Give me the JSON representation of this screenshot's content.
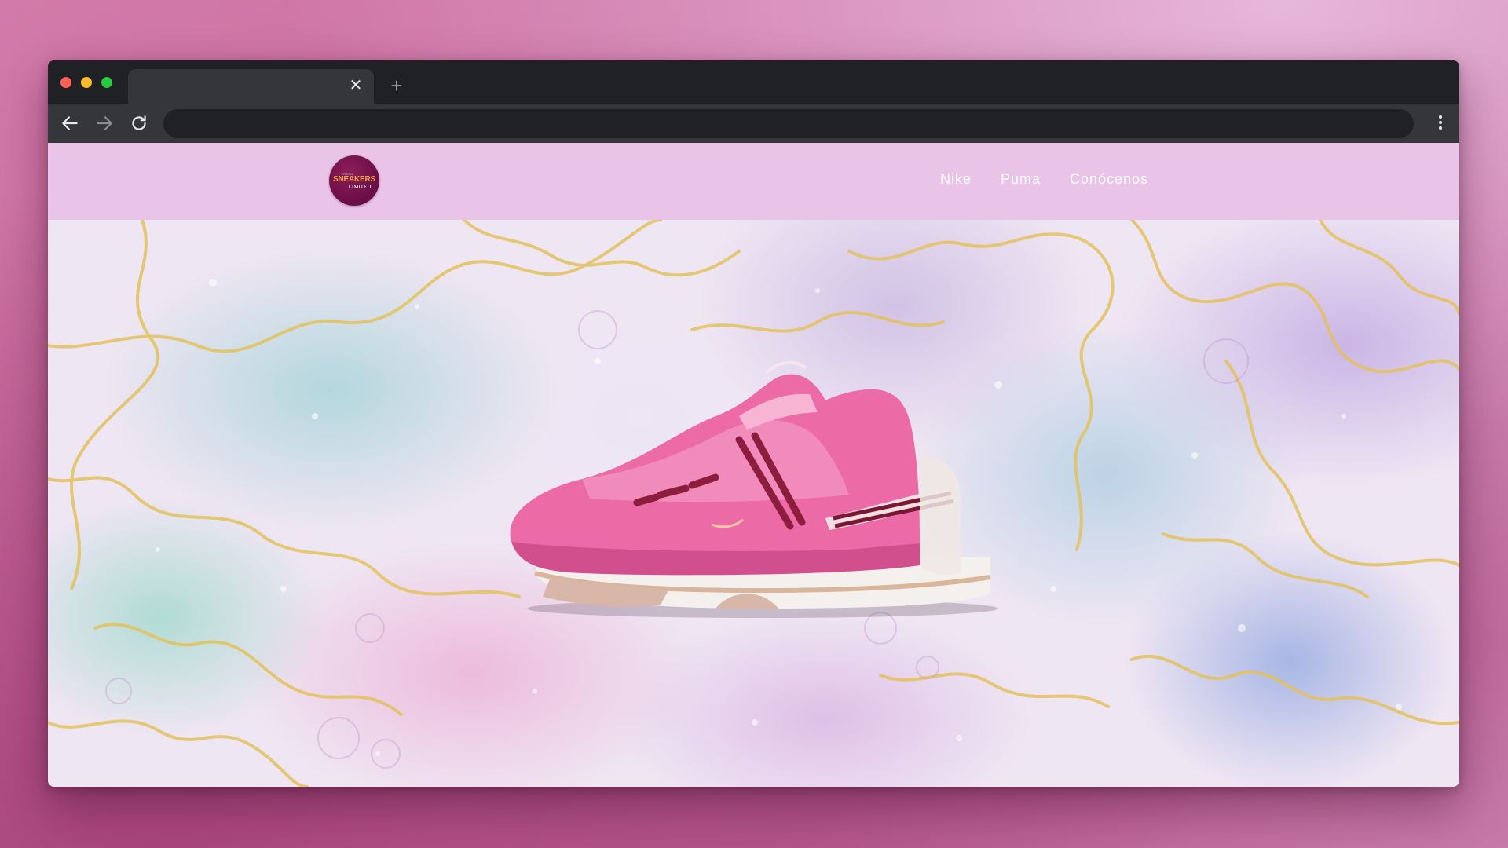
{
  "browser": {
    "tab_title": "",
    "tab_close_icon": "close-icon",
    "new_tab_icon": "plus-icon",
    "address_value": "",
    "nav": {
      "back_icon": "arrow-left-icon",
      "forward_icon": "arrow-right-icon",
      "reload_icon": "reload-icon",
      "menu_icon": "kebab-menu-icon"
    }
  },
  "site": {
    "logo": {
      "top_text": "FRESH",
      "main_text": "SNEAKERS",
      "sub_text": "LIMITED"
    },
    "nav": [
      {
        "label": "Nike"
      },
      {
        "label": "Puma"
      },
      {
        "label": "Conócenos"
      }
    ]
  },
  "hero": {
    "image": "pink-sneaker",
    "background": "pastel-watercolor-marble-with-gold-veins"
  },
  "colors": {
    "header_bg": "#e9c3e8",
    "logo_bg": "#6f0f48",
    "logo_text": "#f0a348",
    "sneaker_pink": "#ec6aa6"
  }
}
